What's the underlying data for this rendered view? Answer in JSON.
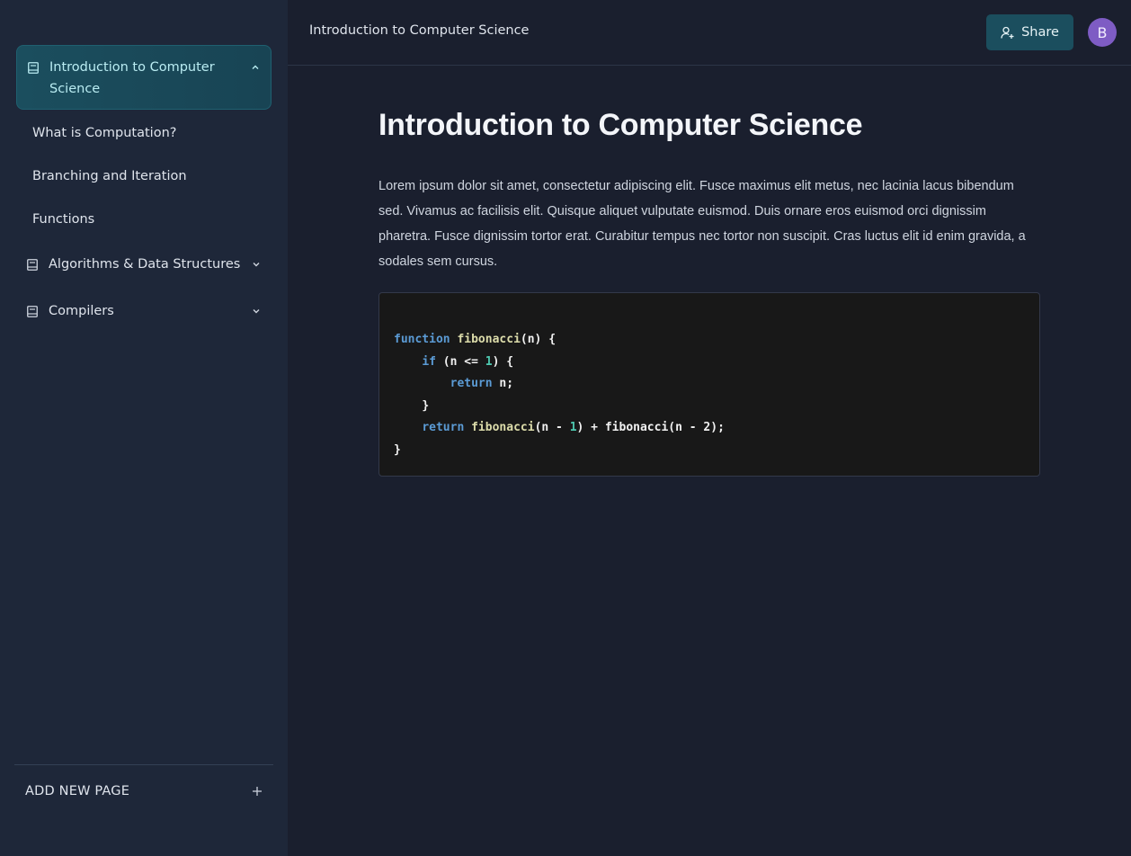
{
  "sidebar": {
    "groups": [
      {
        "label": "Introduction to Computer Science",
        "expanded": true,
        "icon": "book-icon",
        "chevron": "chevron-up-icon"
      },
      {
        "label": "Algorithms & Data Structures",
        "expanded": false,
        "icon": "book-icon",
        "chevron": "chevron-down-icon"
      },
      {
        "label": "Compilers",
        "expanded": false,
        "icon": "book-icon",
        "chevron": "chevron-down-icon"
      }
    ],
    "sub_items": [
      "What is Computation?",
      "Branching and Iteration",
      "Functions"
    ],
    "add_page_label": "ADD NEW PAGE",
    "add_page_icon": "plus-icon"
  },
  "header": {
    "breadcrumb": "Introduction to Computer Science",
    "share_label": "Share",
    "share_icon": "user-plus-icon",
    "avatar_initial": "B",
    "avatar_color": "#7e5cc4"
  },
  "main": {
    "title": "Introduction to Computer Science",
    "paragraph": "Lorem ipsum dolor sit amet, consectetur adipiscing elit. Fusce maximus elit metus, nec lacinia lacus bibendum sed. Vivamus ac facilisis elit. Quisque aliquet vulputate euismod. Duis ornare eros euismod orci dignissim pharetra. Fusce dignissim tortor erat. Curabitur tempus nec tortor non suscipit. Cras luctus elit id enim gravida, a sodales sem cursus.",
    "code": {
      "language": "javascript",
      "lines": [
        {
          "indent": "",
          "kw1": "function",
          "sp1": " ",
          "fn1": "fibonacci",
          "rest1": "(n) {",
          "num": "",
          "rest2": ""
        },
        {
          "indent": "    ",
          "kw1": "if",
          "sp1": " ",
          "fn1": "",
          "rest1": "(n <= ",
          "num": "1",
          "rest2": ") {"
        },
        {
          "indent": "        ",
          "kw1": "return",
          "sp1": " ",
          "fn1": "",
          "rest1": "n;",
          "num": "",
          "rest2": ""
        },
        {
          "indent": "    ",
          "kw1": "",
          "sp1": "",
          "fn1": "",
          "rest1": "}",
          "num": "",
          "rest2": ""
        },
        {
          "indent": "    ",
          "kw1": "return",
          "sp1": " ",
          "fn1": "fibonacci",
          "rest1": "(n - ",
          "num": "1",
          "rest2": ") + fibonacci(n - 2);"
        },
        {
          "indent": "",
          "kw1": "",
          "sp1": "",
          "fn1": "",
          "rest1": "}",
          "num": "",
          "rest2": ""
        }
      ]
    }
  },
  "colors": {
    "accent": "#1b4e5e",
    "sidebar_bg": "#1e2739",
    "main_bg": "#1a1f2e",
    "code_bg": "#181818"
  }
}
